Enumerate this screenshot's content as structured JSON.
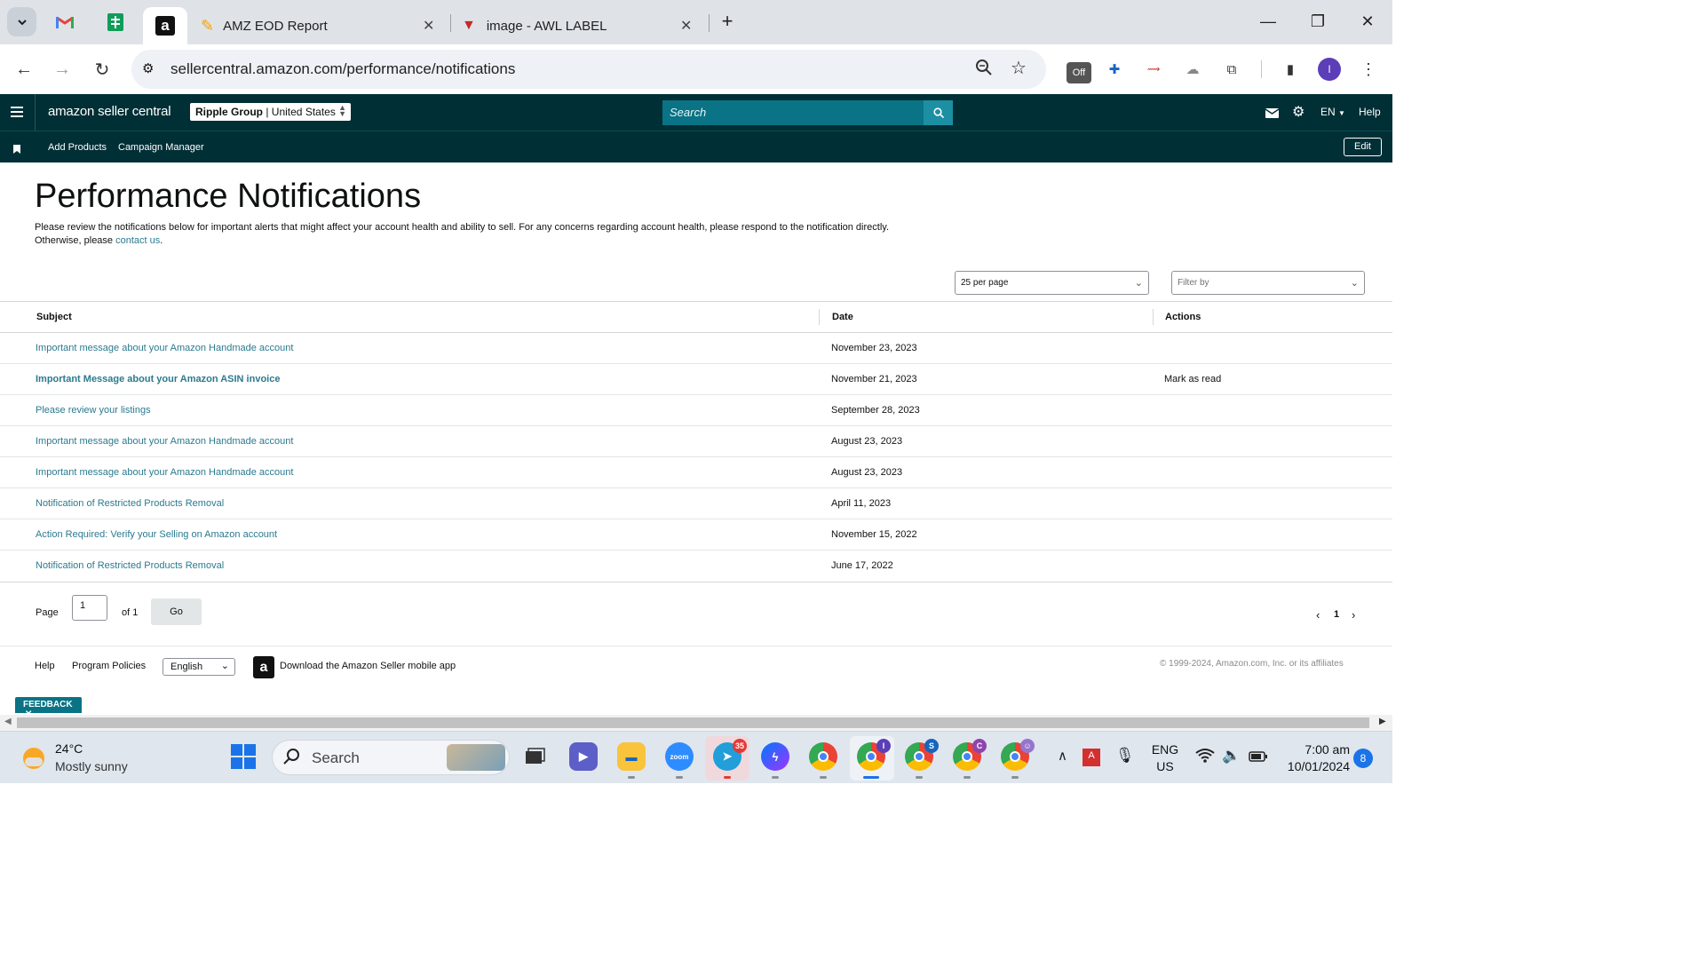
{
  "browser": {
    "tabs": [
      {
        "title": "AMZ EOD Report"
      },
      {
        "title": "image - AWL LABEL"
      }
    ],
    "url": "sellercentral.amazon.com/performance/notifications",
    "new_tab_symbol": "+",
    "profile_initial": "I",
    "extension_off_label": "Off"
  },
  "sc_header": {
    "logo": "amazon seller central",
    "account_name": "Ripple Group",
    "account_region": "United States",
    "search_placeholder": "Search",
    "language": "EN",
    "help": "Help",
    "shortcuts": [
      "Add Products",
      "Campaign Manager"
    ],
    "edit": "Edit"
  },
  "page": {
    "title": "Performance Notifications",
    "intro": "Please review the notifications below for important alerts that might affect your account health and ability to sell. For any concerns regarding account health, please respond to the notification directly. Otherwise, please",
    "intro_link": "contact us",
    "intro_end": ".",
    "per_page": "25 per page",
    "filter_placeholder": "Filter by"
  },
  "table": {
    "columns": [
      "Subject",
      "Date",
      "Actions"
    ],
    "rows": [
      {
        "subject": "Important message about your Amazon Handmade account",
        "date": "November 23, 2023",
        "action": ""
      },
      {
        "subject": "Important Message about your Amazon ASIN invoice",
        "date": "November 21, 2023",
        "action": "Mark as read",
        "unread": true
      },
      {
        "subject": "Please review your listings",
        "date": "September 28, 2023",
        "action": ""
      },
      {
        "subject": "Important message about your Amazon Handmade account",
        "date": "August 23, 2023",
        "action": ""
      },
      {
        "subject": "Important message about your Amazon Handmade account",
        "date": "August 23, 2023",
        "action": ""
      },
      {
        "subject": "Notification of Restricted Products Removal",
        "date": "April 11, 2023",
        "action": ""
      },
      {
        "subject": "Action Required: Verify your Selling on Amazon account",
        "date": "November 15, 2022",
        "action": ""
      },
      {
        "subject": "Notification of Restricted Products Removal",
        "date": "June 17, 2022",
        "action": ""
      }
    ]
  },
  "pagination": {
    "page_label": "Page",
    "page_value": "1",
    "of_label": "of 1",
    "go": "Go",
    "current": "1"
  },
  "footer": {
    "help": "Help",
    "program_policies": "Program Policies",
    "language": "English",
    "download_app": "Download the Amazon Seller mobile app",
    "copyright": "© 1999-2024, Amazon.com, Inc. or its affiliates",
    "feedback": "FEEDBACK"
  },
  "taskbar": {
    "weather_temp": "24°C",
    "weather_desc": "Mostly sunny",
    "search": "Search",
    "lang_top": "ENG",
    "lang_bottom": "US",
    "time": "7:00 am",
    "date": "10/01/2024",
    "notif_count": "8",
    "telegram_badge": "35",
    "zoom_label": "zoom",
    "chrome_profiles": [
      "I",
      "S",
      "C"
    ]
  },
  "colors": {
    "header_bg": "#002f36",
    "link": "#2b7a8f",
    "search_bg": "#0a7385"
  }
}
